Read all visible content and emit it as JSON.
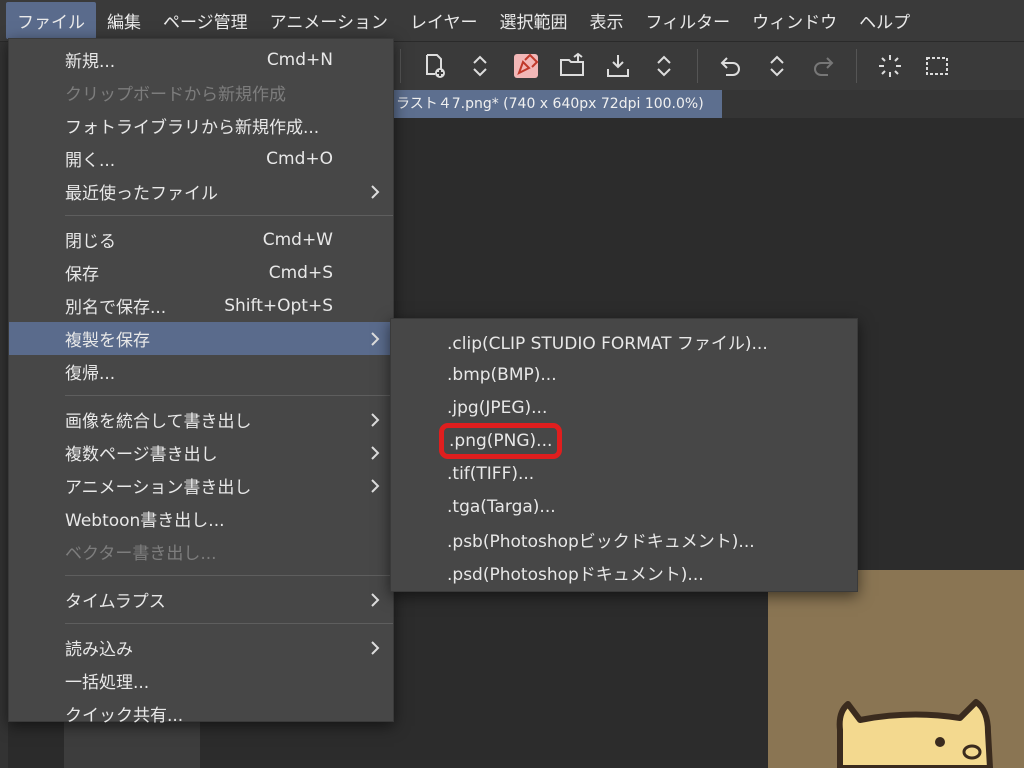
{
  "menubar": {
    "items": [
      "ファイル",
      "編集",
      "ページ管理",
      "アニメーション",
      "レイヤー",
      "選択範囲",
      "表示",
      "フィルター",
      "ウィンドウ",
      "ヘルプ"
    ],
    "active_index": 0
  },
  "document": {
    "tab_title": "ラスト４7.png* (740 x 640px 72dpi 100.0%)"
  },
  "file_menu": {
    "items": [
      {
        "label": "新規...",
        "shortcut": "Cmd+N"
      },
      {
        "label": "クリップボードから新規作成",
        "disabled": true
      },
      {
        "label": "フォトライブラリから新規作成..."
      },
      {
        "label": "開く...",
        "shortcut": "Cmd+O"
      },
      {
        "label": "最近使ったファイル",
        "submenu": true
      },
      {
        "label": "閉じる",
        "shortcut": "Cmd+W"
      },
      {
        "label": "保存",
        "shortcut": "Cmd+S"
      },
      {
        "label": "別名で保存...",
        "shortcut": "Shift+Opt+S"
      },
      {
        "label": "複製を保存",
        "submenu": true,
        "highlight": true
      },
      {
        "label": "復帰..."
      },
      {
        "label": "画像を統合して書き出し",
        "submenu": true
      },
      {
        "label": "複数ページ書き出し",
        "submenu": true
      },
      {
        "label": "アニメーション書き出し",
        "submenu": true
      },
      {
        "label": "Webtoon書き出し..."
      },
      {
        "label": "ベクター書き出し...",
        "disabled": true
      },
      {
        "label": "タイムラプス",
        "submenu": true
      },
      {
        "label": "読み込み",
        "submenu": true
      },
      {
        "label": "一括処理..."
      },
      {
        "label": "クイック共有..."
      }
    ]
  },
  "save_copy_submenu": {
    "items": [
      {
        "label": ".clip(CLIP STUDIO FORMAT ファイル)..."
      },
      {
        "label": ".bmp(BMP)..."
      },
      {
        "label": ".jpg(JPEG)..."
      },
      {
        "label": ".png(PNG)...",
        "highlighted_box": true
      },
      {
        "label": ".tif(TIFF)..."
      },
      {
        "label": ".tga(Targa)..."
      },
      {
        "label": ".psb(Photoshopビックドキュメント)..."
      },
      {
        "label": ".psd(Photoshopドキュメント)..."
      }
    ]
  },
  "colors": {
    "menu_bg": "#474747",
    "highlight": "#5a6b8c",
    "red_box": "#e01e1e",
    "canvas_paper": "#8a7553"
  }
}
